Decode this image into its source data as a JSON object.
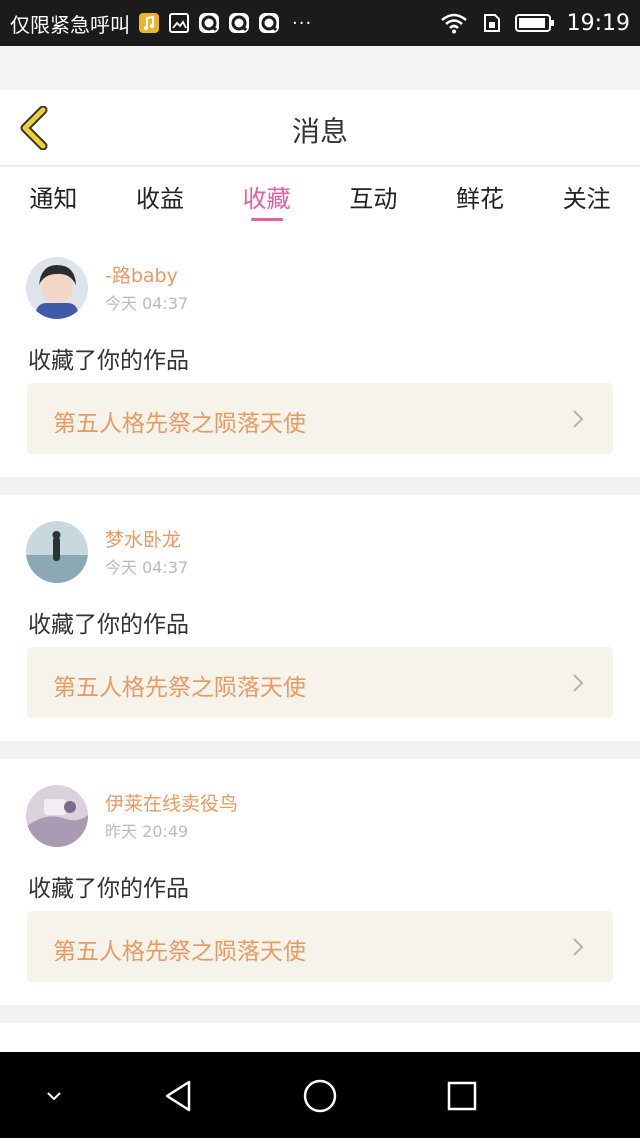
{
  "status_bar": {
    "carrier": "仅限紧急呼叫",
    "icons": [
      "music-icon",
      "gallery-icon",
      "qq-icon",
      "qq-icon",
      "qq-icon",
      "more-icon",
      "wifi-icon",
      "sim-icon",
      "battery-icon"
    ],
    "more": "···",
    "time": "19:19"
  },
  "header": {
    "title": "消息",
    "back_icon": "chevron-left-icon",
    "accent_color": "#f2d230"
  },
  "tabs": [
    {
      "label": "通知",
      "active": false
    },
    {
      "label": "收益",
      "active": false
    },
    {
      "label": "收藏",
      "active": true
    },
    {
      "label": "互动",
      "active": false
    },
    {
      "label": "鲜花",
      "active": false
    },
    {
      "label": "关注",
      "active": false
    }
  ],
  "active_tab_color": "#e55ea2",
  "items": [
    {
      "username": "-路baby  ",
      "time": "今天 04:37",
      "action": "收藏了你的作品",
      "work_title": "第五人格先祭之陨落天使"
    },
    {
      "username": "梦水卧龙",
      "time": "今天 04:37",
      "action": "收藏了你的作品",
      "work_title": "第五人格先祭之陨落天使"
    },
    {
      "username": "伊莱在线卖役鸟",
      "time": "昨天 20:49",
      "action": "收藏了你的作品",
      "work_title": "第五人格先祭之陨落天使"
    }
  ],
  "colors": {
    "username": "#e89a64",
    "work_box_bg": "#f5f3ea"
  },
  "nav_bar": {
    "icons": [
      "chevron-down-icon",
      "back-triangle-icon",
      "home-circle-icon",
      "recents-square-icon"
    ]
  }
}
